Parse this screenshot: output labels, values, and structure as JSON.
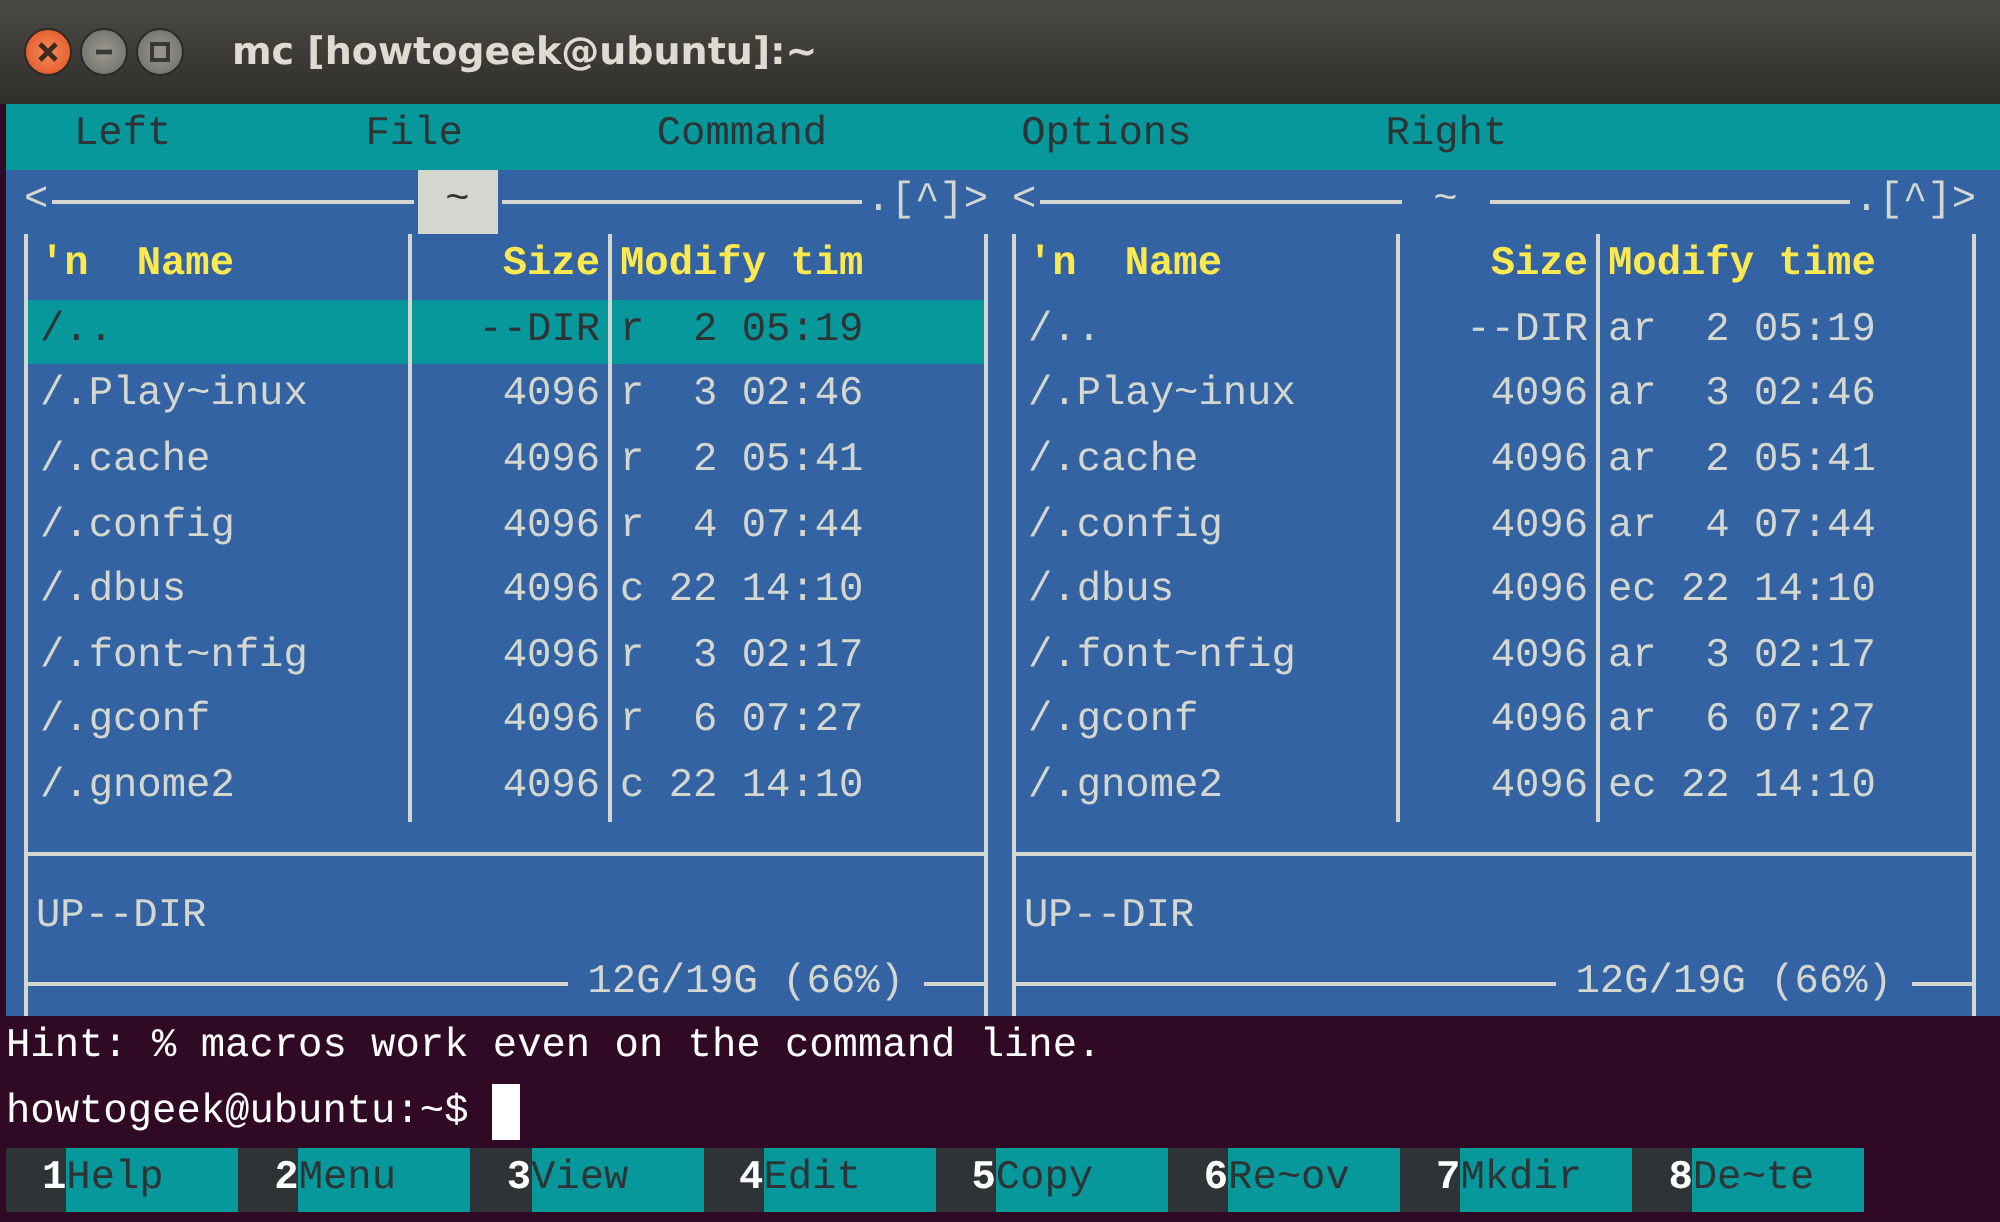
{
  "window": {
    "title": "mc [howtogeek@ubuntu]:~"
  },
  "menu": [
    "Left",
    "File",
    "Command",
    "Options",
    "Right"
  ],
  "panels": [
    {
      "active": true,
      "nav_left": "<",
      "path": "~",
      "nav_right": ".[^]>",
      "columns": [
        "'n",
        "Name",
        "Size",
        "Modify tim"
      ],
      "rows": [
        {
          "name": "/..",
          "size": "--DIR",
          "time": "r  2 05:19",
          "selected": true
        },
        {
          "name": "/.Play~inux",
          "size": "4096",
          "time": "r  3 02:46",
          "selected": false
        },
        {
          "name": "/.cache",
          "size": "4096",
          "time": "r  2 05:41",
          "selected": false
        },
        {
          "name": "/.config",
          "size": "4096",
          "time": "r  4 07:44",
          "selected": false
        },
        {
          "name": "/.dbus",
          "size": "4096",
          "time": "c 22 14:10",
          "selected": false
        },
        {
          "name": "/.font~nfig",
          "size": "4096",
          "time": "r  3 02:17",
          "selected": false
        },
        {
          "name": "/.gconf",
          "size": "4096",
          "time": "r  6 07:27",
          "selected": false
        },
        {
          "name": "/.gnome2",
          "size": "4096",
          "time": "c 22 14:10",
          "selected": false
        }
      ],
      "mini_status": "UP--DIR",
      "disk": "12G/19G (66%)"
    },
    {
      "active": false,
      "nav_left": "<",
      "path": "~",
      "nav_right": ".[^]>",
      "columns": [
        "'n",
        "Name",
        "Size",
        "Modify time"
      ],
      "rows": [
        {
          "name": "/..",
          "size": "--DIR",
          "time": "ar  2 05:19",
          "selected": false
        },
        {
          "name": "/.Play~inux",
          "size": "4096",
          "time": "ar  3 02:46",
          "selected": false
        },
        {
          "name": "/.cache",
          "size": "4096",
          "time": "ar  2 05:41",
          "selected": false
        },
        {
          "name": "/.config",
          "size": "4096",
          "time": "ar  4 07:44",
          "selected": false
        },
        {
          "name": "/.dbus",
          "size": "4096",
          "time": "ec 22 14:10",
          "selected": false
        },
        {
          "name": "/.font~nfig",
          "size": "4096",
          "time": "ar  3 02:17",
          "selected": false
        },
        {
          "name": "/.gconf",
          "size": "4096",
          "time": "ar  6 07:27",
          "selected": false
        },
        {
          "name": "/.gnome2",
          "size": "4096",
          "time": "ec 22 14:10",
          "selected": false
        }
      ],
      "mini_status": "UP--DIR",
      "disk": "12G/19G (66%)"
    }
  ],
  "hint": "Hint: % macros work even on the command line.",
  "prompt": "howtogeek@ubuntu:~$",
  "function_keys": [
    {
      "number": "1",
      "label": "Help"
    },
    {
      "number": "2",
      "label": "Menu"
    },
    {
      "number": "3",
      "label": "View"
    },
    {
      "number": "4",
      "label": "Edit"
    },
    {
      "number": "5",
      "label": "Copy"
    },
    {
      "number": "6",
      "label": "Re~ov"
    },
    {
      "number": "7",
      "label": "Mkdir"
    },
    {
      "number": "8",
      "label": "De~te"
    }
  ]
}
